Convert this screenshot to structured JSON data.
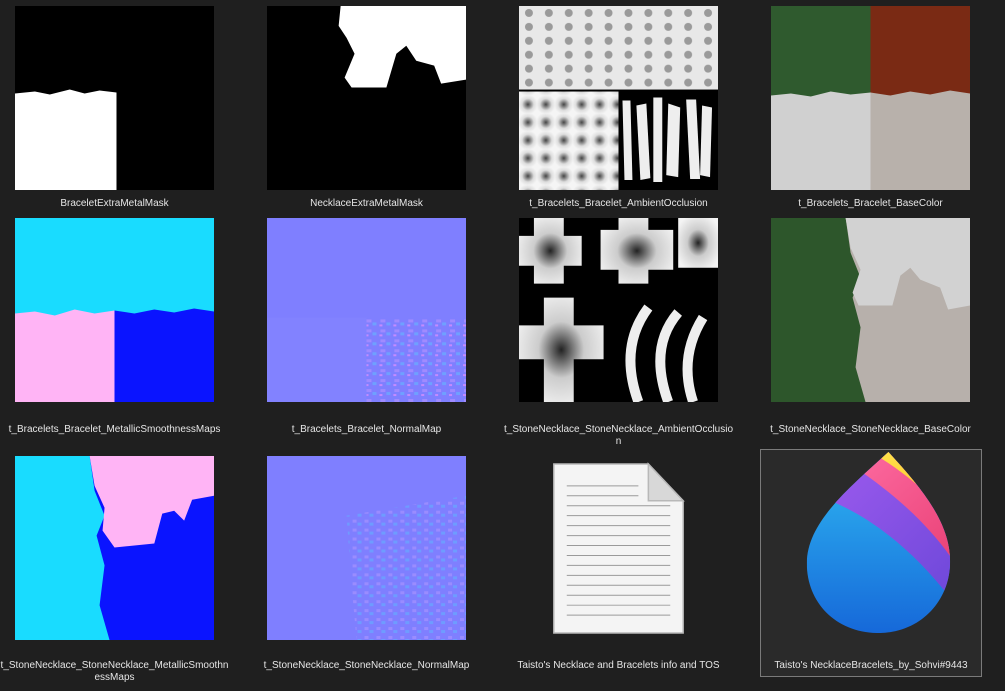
{
  "explorer": {
    "files": [
      {
        "name": "BraceletExtraMetalMask",
        "kind": "image",
        "thumbnail": "bracelet-metal-mask"
      },
      {
        "name": "NecklaceExtraMetalMask",
        "kind": "image",
        "thumbnail": "necklace-metal-mask"
      },
      {
        "name": "t_Bracelets_Bracelet_AmbientOcclusion",
        "kind": "image",
        "thumbnail": "bracelet-ambient-occlusion"
      },
      {
        "name": "t_Bracelets_Bracelet_BaseColor",
        "kind": "image",
        "thumbnail": "bracelet-base-color"
      },
      {
        "name": "t_Bracelets_Bracelet_MetallicSmoothnessMaps",
        "kind": "image",
        "thumbnail": "bracelet-metallic-smoothness"
      },
      {
        "name": "t_Bracelets_Bracelet_NormalMap",
        "kind": "image",
        "thumbnail": "bracelet-normal-map"
      },
      {
        "name": "t_StoneNecklace_StoneNecklace_AmbientOcclusion",
        "kind": "image",
        "thumbnail": "necklace-ambient-occlusion"
      },
      {
        "name": "t_StoneNecklace_StoneNecklace_BaseColor",
        "kind": "image",
        "thumbnail": "necklace-base-color"
      },
      {
        "name": "t_StoneNecklace_StoneNecklace_MetallicSmoothnessMaps",
        "kind": "image",
        "thumbnail": "necklace-metallic-smoothness"
      },
      {
        "name": "t_StoneNecklace_StoneNecklace_NormalMap",
        "kind": "image",
        "thumbnail": "necklace-normal-map"
      },
      {
        "name": "Taisto's Necklace and Bracelets info and TOS",
        "kind": "text-document",
        "thumbnail": "document-icon"
      },
      {
        "name": "Taisto's NecklaceBracelets_by_Sohvi#9443",
        "kind": "paint-project",
        "thumbnail": "paint-app-icon",
        "selected": true
      }
    ]
  },
  "colors": {
    "background": "#1f1f1f",
    "caption_text": "#e6e6e6",
    "selection_border": "#7a7a7a",
    "normal_map": "#7f7fff",
    "mask_white": "#ffffff",
    "mask_black": "#000000",
    "smoothness_cyan": "#19dcff",
    "smoothness_pink": "#ffb4f5",
    "smoothness_blue": "#0a14ff",
    "base_green": "#2f5a2e",
    "base_red": "#7a2a14",
    "base_silver": "#cfcfcf"
  }
}
